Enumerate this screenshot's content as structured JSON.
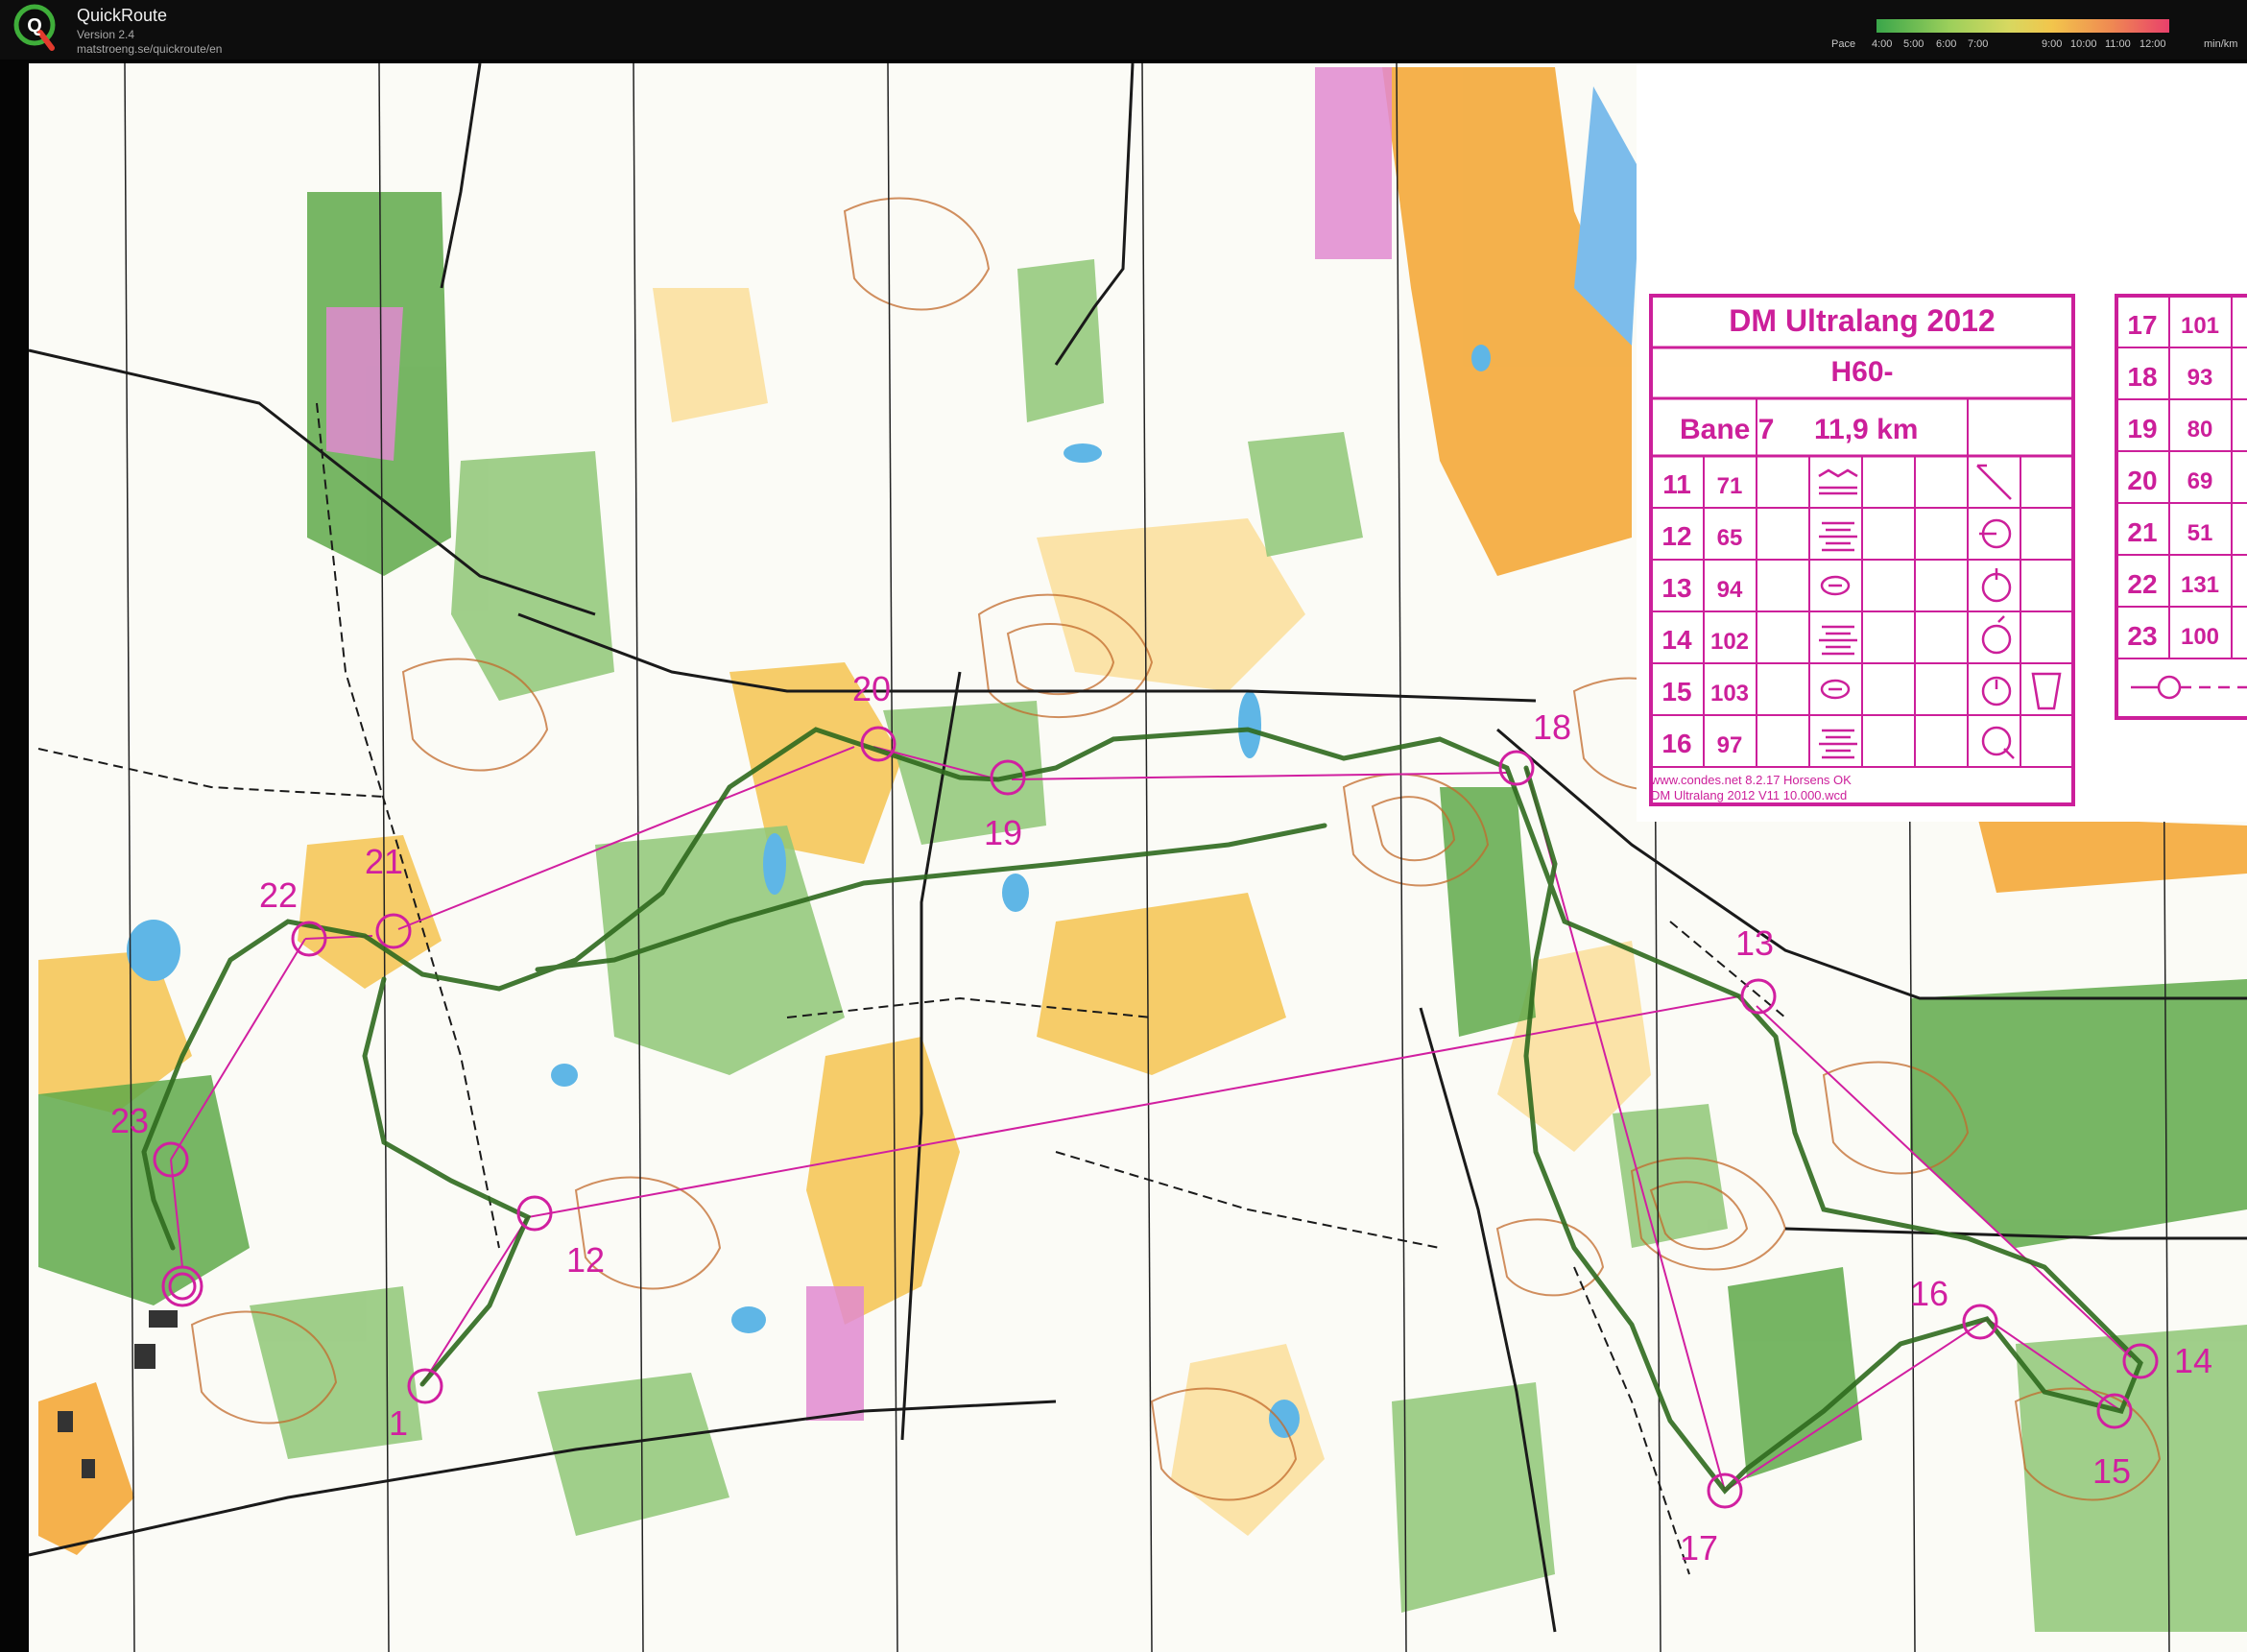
{
  "app": {
    "name": "QuickRoute",
    "version": "Version 2.4",
    "url": "matstroeng.se/quickroute/en",
    "logo_letter": "Q"
  },
  "pace_legend": {
    "label": "Pace",
    "ticks": [
      "4:00",
      "5:00",
      "6:00",
      "7:00",
      "9:00",
      "10:00",
      "11:00",
      "12:00"
    ],
    "unit": "min/km"
  },
  "course": {
    "title": "DM Ultralang 2012",
    "class": "H60-",
    "course_name": "Bane 7",
    "length": "11,9 km",
    "footer_line1": "www.condes.net 8.2.17 Horsens OK",
    "footer_line2": "DM Ultralang 2012 V11 10.000.wcd",
    "controls_left": [
      {
        "num": "11",
        "code": "71"
      },
      {
        "num": "12",
        "code": "65"
      },
      {
        "num": "13",
        "code": "94"
      },
      {
        "num": "14",
        "code": "102"
      },
      {
        "num": "15",
        "code": "103"
      },
      {
        "num": "16",
        "code": "97"
      }
    ],
    "controls_right": [
      {
        "num": "17",
        "code": "101"
      },
      {
        "num": "18",
        "code": "93"
      },
      {
        "num": "19",
        "code": "80"
      },
      {
        "num": "20",
        "code": "69"
      },
      {
        "num": "21",
        "code": "51"
      },
      {
        "num": "22",
        "code": "131"
      },
      {
        "num": "23",
        "code": "100"
      }
    ]
  },
  "map_labels": [
    "1",
    "12",
    "13",
    "14",
    "15",
    "16",
    "17",
    "18",
    "19",
    "20",
    "21",
    "22",
    "23"
  ],
  "colors": {
    "course_magenta": "#d11fa0",
    "route_green": "#2f6a1e",
    "open_land_yellow": "#f5c75a",
    "rough_open_yellow": "#fbe7a8",
    "forest_green": "#8fc777",
    "dense_green": "#5fa94a",
    "water_blue": "#5fb6e6",
    "contour_brown": "#c26a2b",
    "paper_white": "#fbfbf6"
  }
}
